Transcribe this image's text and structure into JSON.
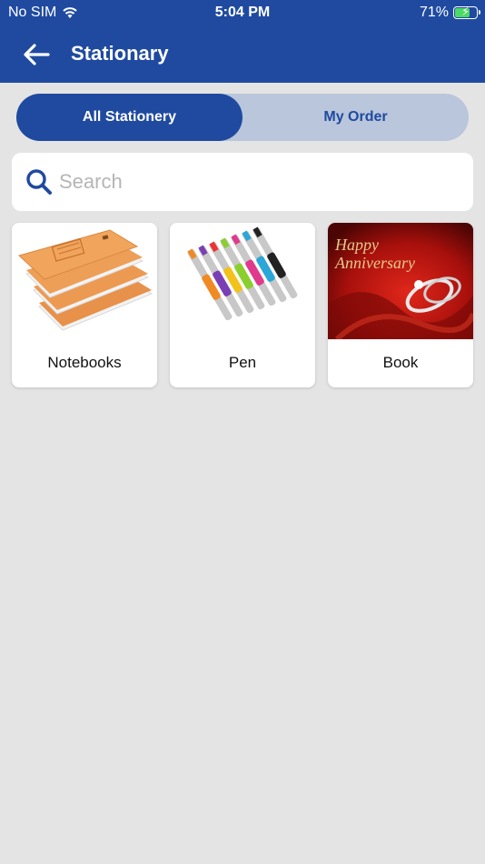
{
  "status_bar": {
    "carrier": "No SIM",
    "time": "5:04 PM",
    "battery_percent": "71%",
    "battery_level": 0.71,
    "wifi_icon": "wifi-icon",
    "battery_icon": "battery-charging-icon"
  },
  "header": {
    "title": "Stationary",
    "back_icon": "arrow-left-icon",
    "color": "#1f4aa0"
  },
  "tabs": [
    {
      "label": "All Stationery",
      "active": true
    },
    {
      "label": "My Order",
      "active": false
    }
  ],
  "search": {
    "placeholder": "Search",
    "value": "",
    "icon": "search-icon"
  },
  "categories": [
    {
      "label": "Notebooks",
      "image": "notebooks-stack-image"
    },
    {
      "label": "Pen",
      "image": "colored-pens-image"
    },
    {
      "label": "Book",
      "image": "anniversary-rings-image"
    }
  ],
  "book_image_text": [
    "Happy",
    "Anniversary"
  ],
  "colors": {
    "primary": "#1f4aa0",
    "tab_inactive_bg": "#b9c6db",
    "background": "#e4e4e4"
  }
}
